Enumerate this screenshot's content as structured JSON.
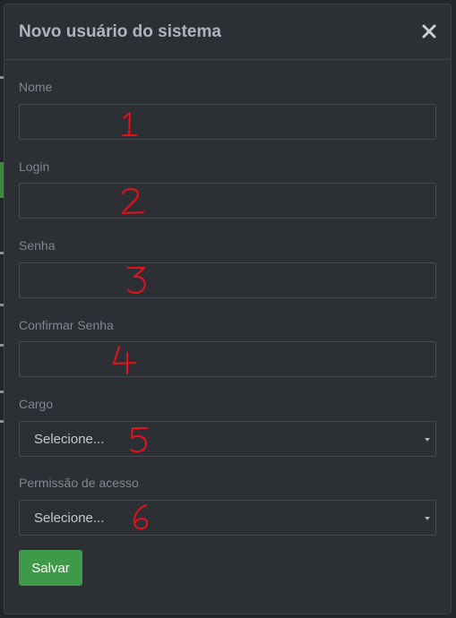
{
  "modal": {
    "title": "Novo usuário do sistema",
    "close_icon": "close-icon"
  },
  "fields": {
    "nome": {
      "label": "Nome",
      "value": "",
      "annotation": "1"
    },
    "login": {
      "label": "Login",
      "value": "",
      "annotation": "2"
    },
    "senha": {
      "label": "Senha",
      "value": "",
      "annotation": "3"
    },
    "confirmar_senha": {
      "label": "Confirmar Senha",
      "value": "",
      "annotation": "4"
    },
    "cargo": {
      "label": "Cargo",
      "selected": "Selecione...",
      "annotation": "5"
    },
    "permissao": {
      "label": "Permissão de acesso",
      "selected": "Selecione...",
      "annotation": "6"
    }
  },
  "actions": {
    "save_label": "Salvar"
  },
  "colors": {
    "modal_bg": "#2c3035",
    "save_button": "#3e9a48",
    "annotation_red": "#e8101a"
  }
}
